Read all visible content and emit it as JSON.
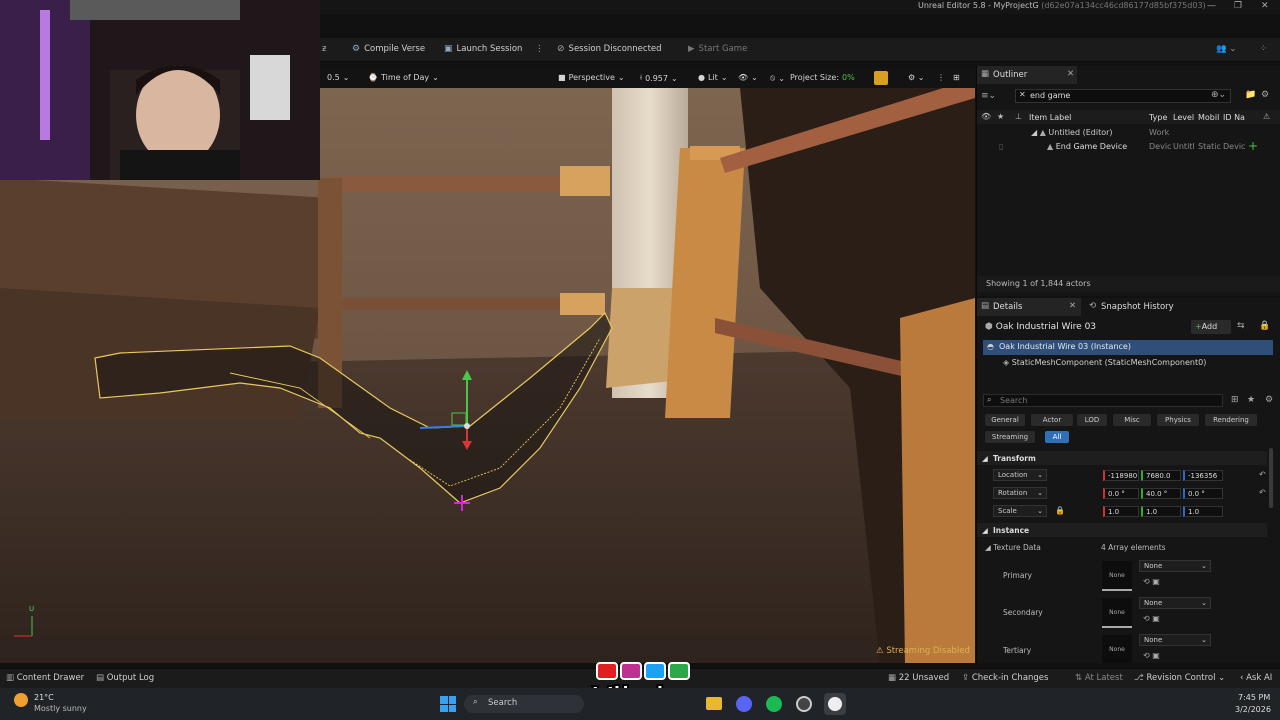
{
  "window": {
    "title": "Unreal Editor 5.8 - MyProjectG",
    "title_hash": "(d62e07a134cc46cd86177d85bf375d03)"
  },
  "toolbar": {
    "compile_verse": "Compile Verse",
    "launch_session": "Launch Session",
    "session_status": "Session Disconnected",
    "start_game": "Start Game"
  },
  "viewport_bar": {
    "speed": "0.5",
    "time_of_day": "Time of Day",
    "perspective": "Perspective",
    "fov": "0.957",
    "lit": "Lit",
    "project_size_label": "Project Size:",
    "project_size_value": "0%"
  },
  "viewport": {
    "streaming_status": "Streaming Disabled",
    "axis_label": "U"
  },
  "outliner": {
    "tab": "Outliner",
    "search_value": "end game",
    "columns": [
      "Item Label",
      "Type",
      "Level",
      "Mobil",
      "ID Na"
    ],
    "rows": [
      {
        "label": "Untitled (Editor)",
        "type": "Work",
        "level": "",
        "mobil": "",
        "id": ""
      },
      {
        "label": "End Game Device",
        "type": "Devic",
        "level": "Untitl",
        "mobil": "Static",
        "id": "Devic"
      }
    ],
    "footer": "Showing 1 of 1,844 actors"
  },
  "details": {
    "tab": "Details",
    "tab2": "Snapshot History",
    "actor_name": "Oak Industrial Wire 03",
    "add_label": "Add",
    "instance_row": "Oak Industrial Wire 03 (Instance)",
    "component_row": "StaticMeshComponent (StaticMeshComponent0)",
    "search_placeholder": "Search",
    "filters": [
      "General",
      "Actor",
      "LOD",
      "Misc",
      "Physics",
      "Rendering",
      "Streaming",
      "All"
    ],
    "transform_header": "Transform",
    "location_label": "Location",
    "location": [
      "-118980",
      "7680.0",
      "-136356"
    ],
    "rotation_label": "Rotation",
    "rotation": [
      "0.0 °",
      "40.0 °",
      "0.0 °"
    ],
    "scale_label": "Scale",
    "scale": [
      "1.0",
      "1.0",
      "1.0"
    ],
    "instance_header": "Instance",
    "texture_data_label": "Texture Data",
    "texture_data_value": "4 Array elements",
    "slots": [
      {
        "name": "Primary",
        "thumb": "None",
        "value": "None"
      },
      {
        "name": "Secondary",
        "thumb": "None",
        "value": "None"
      },
      {
        "name": "Tertiary",
        "thumb": "None",
        "value": "None"
      }
    ]
  },
  "statusbar": {
    "content_drawer": "Content Drawer",
    "output_log": "Output Log",
    "unsaved": "22 Unsaved",
    "check_in": "Check-in Changes",
    "at_latest": "At Latest",
    "revision_control": "Revision Control",
    "ask_ai": "Ask AI"
  },
  "overlay": {
    "brand": "Vibzlo"
  },
  "taskbar": {
    "temperature": "21°C",
    "weather": "Mostly sunny",
    "search": "Search",
    "time": "7:45 PM",
    "date": "3/2/2026"
  },
  "colors": {
    "accent": "#2f6fb7",
    "selection_outline": "#e8c860",
    "project_size_green": "#4cc34c",
    "bg_panel": "#151515"
  }
}
